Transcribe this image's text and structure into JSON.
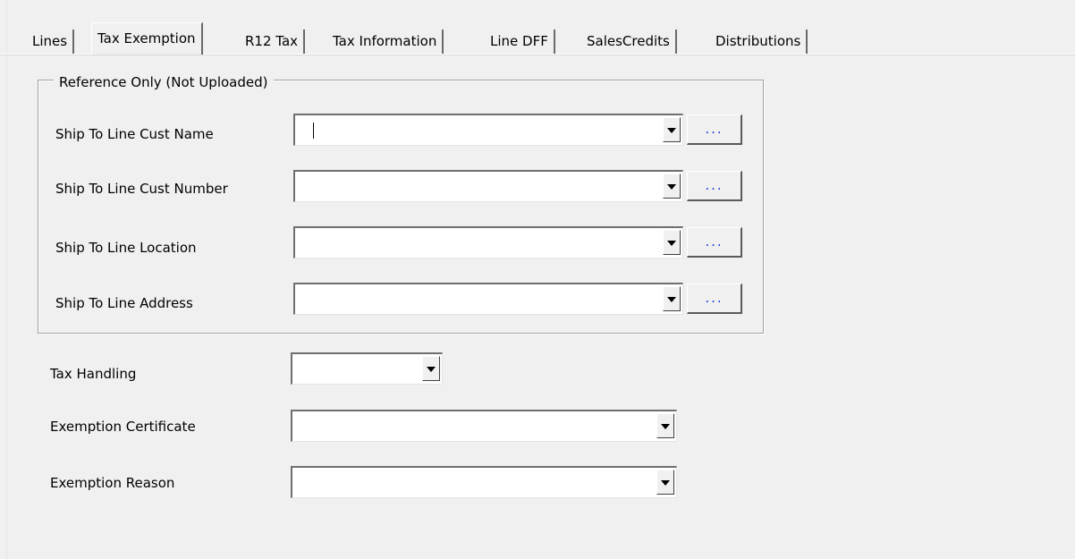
{
  "tabs": [
    {
      "label": "Lines",
      "active": false
    },
    {
      "label": "Tax Exemption",
      "active": true
    },
    {
      "label": "R12 Tax",
      "active": false
    },
    {
      "label": "Tax Information",
      "active": false
    },
    {
      "label": "Line DFF",
      "active": false
    },
    {
      "label": "SalesCredits",
      "active": false
    },
    {
      "label": "Distributions",
      "active": false
    }
  ],
  "reference_group": {
    "legend": "Reference Only (Not Uploaded)",
    "fields": [
      {
        "label": "Ship To Line Cust Name",
        "value": "",
        "lookup_label": "..."
      },
      {
        "label": "Ship To Line Cust Number",
        "value": "",
        "lookup_label": "..."
      },
      {
        "label": "Ship To Line Location",
        "value": "",
        "lookup_label": "..."
      },
      {
        "label": "Ship To Line Address",
        "value": "",
        "lookup_label": "..."
      }
    ]
  },
  "tax_fields": [
    {
      "label": "Tax Handling",
      "value": ""
    },
    {
      "label": "Exemption Certificate",
      "value": ""
    },
    {
      "label": "Exemption Reason",
      "value": ""
    }
  ],
  "colors": {
    "lookup_text": "#1b3ad9",
    "background": "#f0f0f0"
  }
}
